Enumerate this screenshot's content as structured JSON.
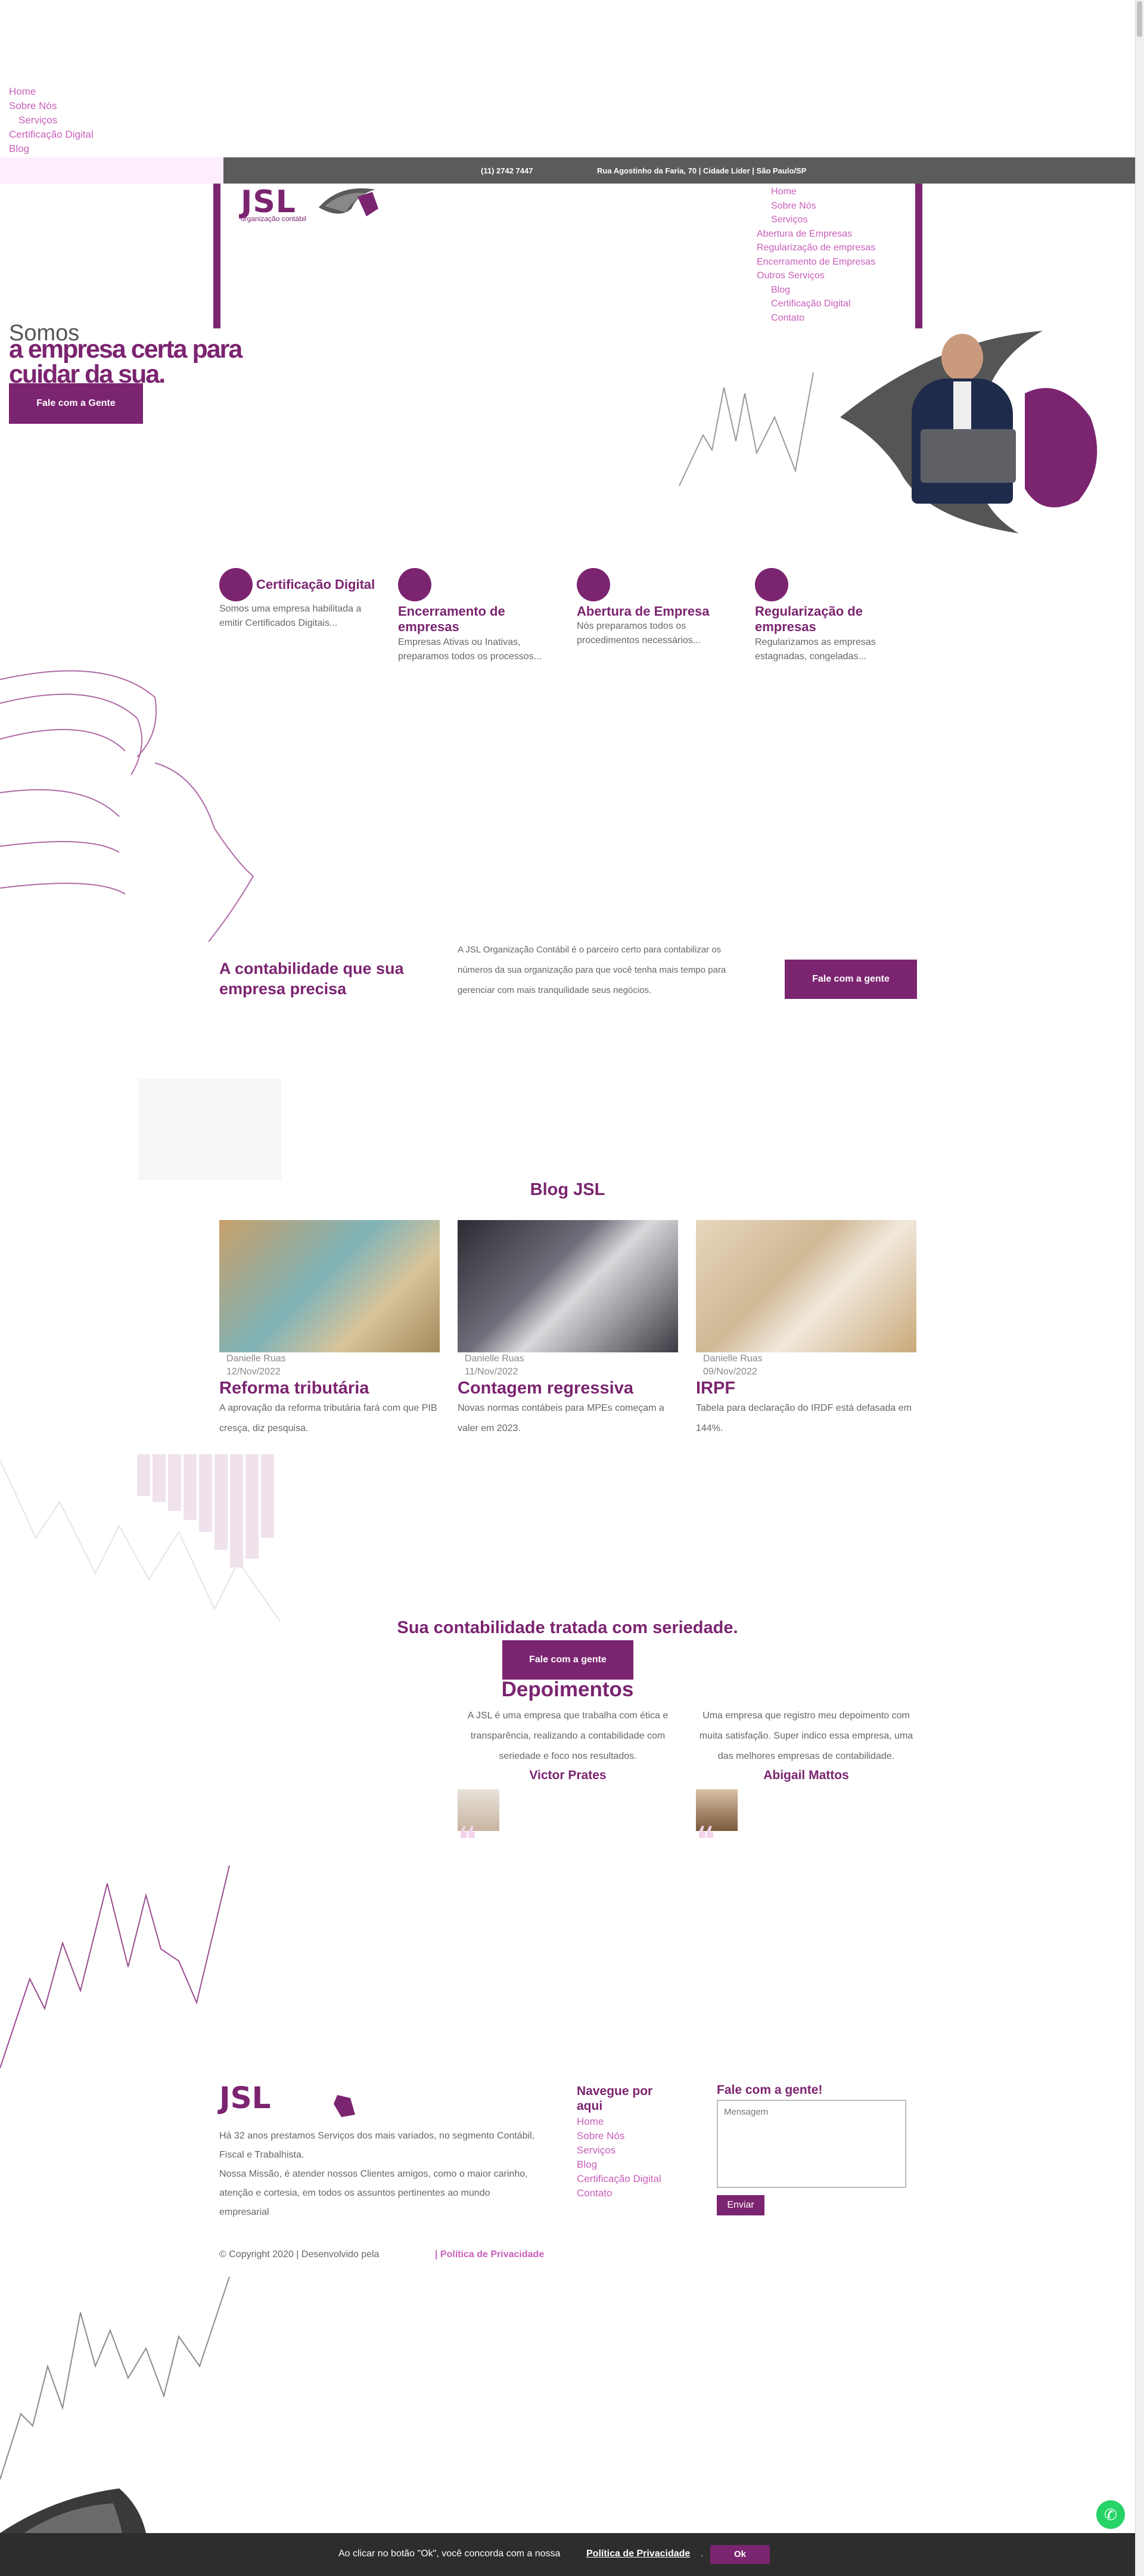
{
  "top_nav": [
    "Home",
    "Sobre Nós",
    "Serviços",
    "Certificação Digital",
    "Blog"
  ],
  "contact_bar": {
    "phone": "(11) 2742 7447",
    "address": "Rua Agostinho da Faria, 70 | Cidade Líder | São Paulo/SP"
  },
  "logo": {
    "name": "JSL",
    "tagline": "organização contábil"
  },
  "site_nav": [
    "Home",
    "Sobre Nós",
    "Serviços",
    "Abertura de Empresas",
    "Regularização de empresas",
    "Encerramento de Empresas",
    "Outros Serviços",
    "Blog",
    "Certificação Digital",
    "Contato"
  ],
  "hero": {
    "small": "Somos",
    "title_line1": "a empresa certa para",
    "title_line2": "cuidar da sua.",
    "button": "Fale com a Gente"
  },
  "services": [
    {
      "title": "Certificação Digital",
      "text": "Somos uma empresa habilitada a emitir Certificados Digitais...",
      "icon": "certificate-icon"
    },
    {
      "title": "Encerramento de empresas",
      "text": "Empresas Ativas ou Inativas, preparamos todos os processos...",
      "icon": "building-close-icon"
    },
    {
      "title": "Abertura de Empresa",
      "text": "Nós preparamos todos os procedimentos necessários...",
      "icon": "building-open-icon"
    },
    {
      "title": "Regularização de empresas",
      "text": "Regularizamos as empresas estagnadas, congeladas...",
      "icon": "document-check-icon"
    }
  ],
  "cta": {
    "title": "A contabilidade que sua empresa precisa",
    "text": "A JSL Organização Contábil é o parceiro certo para contabilizar os números da sua organização para que você tenha mais tempo para gerenciar com mais tranquilidade seus negócios.",
    "button": "Fale com a gente"
  },
  "blog": {
    "heading": "Blog JSL",
    "posts": [
      {
        "author": "Danielle Ruas",
        "date": "12/Nov/2022",
        "title": "Reforma tributária",
        "text": "A aprovação da reforma tributária fará com que PIB cresça, diz pesquisa."
      },
      {
        "author": "Danielle Ruas",
        "date": "11/Nov/2022",
        "title": "Contagem regressiva",
        "text": "Novas normas contábeis para MPEs começam a valer em 2023."
      },
      {
        "author": "Danielle Ruas",
        "date": "09/Nov/2022",
        "title": "IRPF",
        "text": "Tabela para declaração do IRDF está defasada em 144%."
      }
    ]
  },
  "serious": {
    "title": "Sua contabilidade tratada com seriedade.",
    "button": "Fale com a gente"
  },
  "testimonials": {
    "heading": "Depoimentos",
    "items": [
      {
        "text": "A JSL é uma empresa que trabalha com ética e transparência, realizando a contabilidade com seriedade e foco nos resultados.",
        "name": "Victor Prates"
      },
      {
        "text": "Uma empresa que registro meu depoimento com muita satisfação. Super indico essa empresa, uma das melhores empresas de contabilidade.",
        "name": "Abigail Mattos"
      }
    ]
  },
  "footer": {
    "logo": "JSL",
    "p1": "Há 32 anos prestamos Serviços dos mais variados, no segmento Contábil, Fiscal e Trabalhista.",
    "p2": "Nossa Missão, é atender nossos Clientes amigos, como o maior carinho, atenção e cortesia, em todos os assuntos pertinentes ao mundo empresarial",
    "nav_heading": "Navegue por aqui",
    "nav": [
      "Home",
      "Sobre Nós",
      "Serviços",
      "Blog",
      "Certificação Digital",
      "Contato"
    ],
    "form_heading": "Fale com a gente!",
    "message_placeholder": "Mensagem",
    "send": "Enviar",
    "copyright": "© Copyright 2020 | Desenvolvido pela",
    "privacy": "| Política de Privacidade"
  },
  "cookie": {
    "text": "Ao clicar no botão \"Ok\", você concorda com a nossa",
    "link": "Política de Privacidade",
    "ok": "Ok"
  },
  "colors": {
    "brand": "#7b2470",
    "link": "#c85fb9",
    "bar": "#5b5b5b"
  }
}
